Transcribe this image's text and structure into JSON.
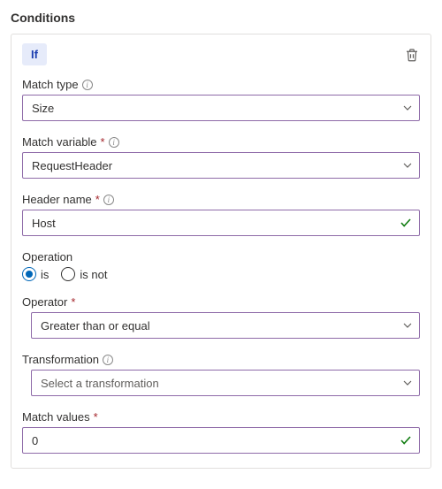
{
  "section_title": "Conditions",
  "if_label": "If",
  "match_type": {
    "label": "Match type",
    "value": "Size"
  },
  "match_variable": {
    "label": "Match variable",
    "value": "RequestHeader"
  },
  "header_name": {
    "label": "Header name",
    "value": "Host"
  },
  "operation": {
    "label": "Operation",
    "opt_is": "is",
    "opt_isnot": "is not",
    "selected": "is"
  },
  "operator": {
    "label": "Operator",
    "value": "Greater than or equal"
  },
  "transformation": {
    "label": "Transformation",
    "placeholder": "Select a transformation"
  },
  "match_values": {
    "label": "Match values",
    "value": "0"
  }
}
